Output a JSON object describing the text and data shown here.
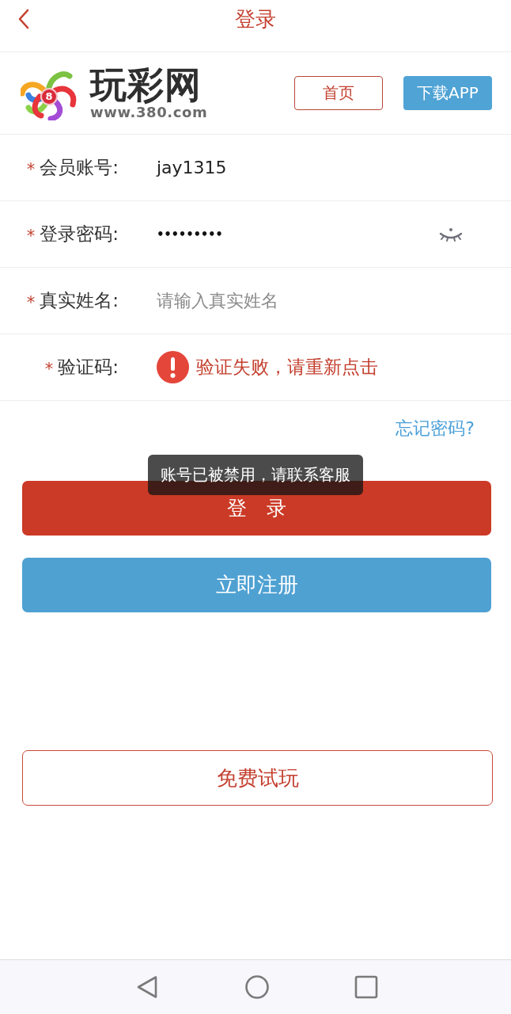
{
  "header": {
    "title": "登录"
  },
  "brand": {
    "name": "玩彩网",
    "url": "www.380.com",
    "badge": "8"
  },
  "top_buttons": [
    {
      "label": "首页",
      "kind": "outline"
    },
    {
      "label": "下载APP",
      "kind": "filled"
    }
  ],
  "fields": [
    {
      "kind": "text",
      "mark": "*",
      "label": "会员账号:",
      "value": "jay1315"
    },
    {
      "kind": "password",
      "mark": "*",
      "label": "登录密码:",
      "value": "•••••••••",
      "revealed": false
    },
    {
      "kind": "text",
      "mark": "*",
      "label": "真实姓名:",
      "placeholder": "请输入真实姓名"
    },
    {
      "kind": "captcha",
      "mark": "*",
      "label": "验证码:",
      "error": "验证失败，请重新点击"
    }
  ],
  "forgot_link": "忘记密码?",
  "actions": [
    {
      "label": "登 录",
      "kind": "primary"
    },
    {
      "label": "立即注册",
      "kind": "secondary"
    }
  ],
  "trial_button": {
    "label": "免费试玩"
  },
  "toast": "账号已被禁用，请联系客服"
}
